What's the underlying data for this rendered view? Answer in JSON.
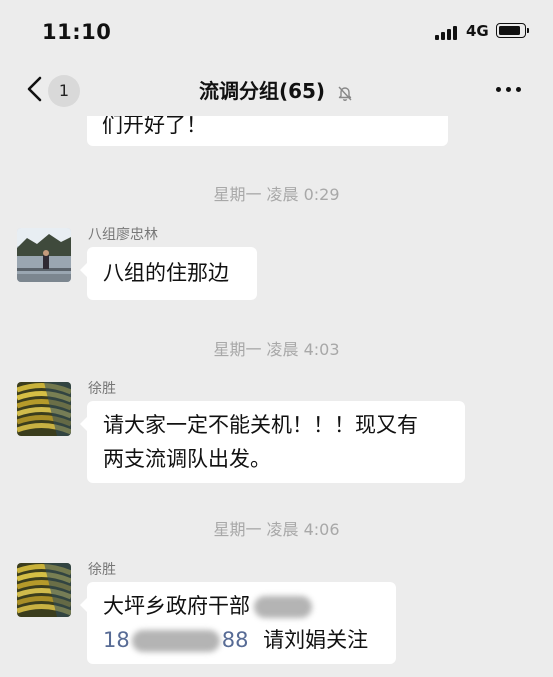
{
  "status_bar": {
    "time": "11:10",
    "network": "4G"
  },
  "header": {
    "unread_count": "1",
    "title": "流调分组(65)"
  },
  "messages": {
    "top_partial": {
      "text": "们开好了！"
    },
    "ts1": "星期一 凌晨 0:29",
    "m1": {
      "sender": "八组廖忠林",
      "text": "八组的住那边"
    },
    "ts2": "星期一 凌晨 4:03",
    "m2": {
      "sender": "徐胜",
      "line1": "请大家一定不能关机！！！现又有",
      "line2": "两支流调队出发。"
    },
    "ts3": "星期一 凌晨 4:06",
    "m3": {
      "sender": "徐胜",
      "line1_prefix": "大坪乡政府干部",
      "phone_start": "18",
      "phone_end": "88",
      "line2_suffix": "请刘娟关注"
    }
  },
  "colors": {
    "background": "#ececec",
    "bubble": "#ffffff",
    "timestamp": "#a8a8a8"
  },
  "icons": [
    "back-chevron-icon",
    "mute-bell-icon",
    "more-dots-icon",
    "signal-icon",
    "battery-icon"
  ]
}
